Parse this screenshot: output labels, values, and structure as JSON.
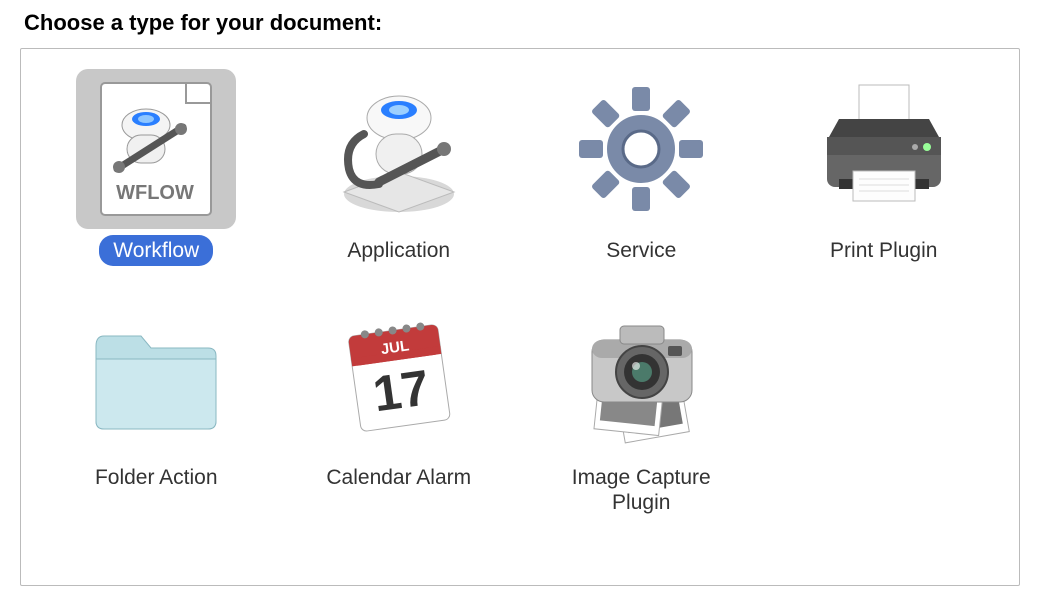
{
  "title": "Choose a type for your document:",
  "items": [
    {
      "label": "Workflow",
      "selected": true
    },
    {
      "label": "Application",
      "selected": false
    },
    {
      "label": "Service",
      "selected": false
    },
    {
      "label": "Print Plugin",
      "selected": false
    },
    {
      "label": "Folder Action",
      "selected": false
    },
    {
      "label": "Calendar Alarm",
      "selected": false
    },
    {
      "label": "Image Capture Plugin",
      "selected": false
    }
  ]
}
